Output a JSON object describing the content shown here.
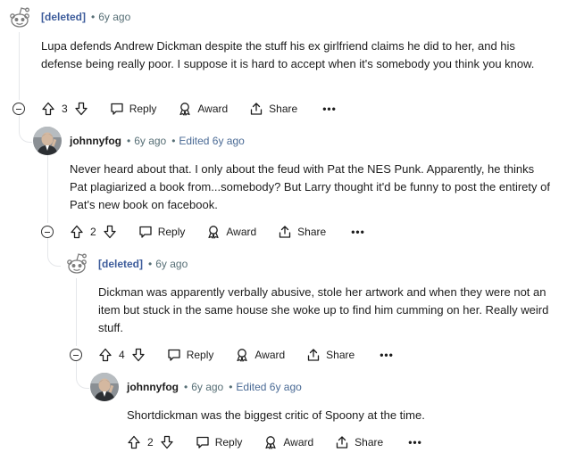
{
  "comments": [
    {
      "user": "[deleted]",
      "time": "6y ago",
      "edited": "",
      "body": "Lupa defends Andrew Dickman despite the stuff his ex girlfriend claims he did to her, and his defense being really poor. I suppose it is hard to accept when it's somebody you think you know.",
      "votes": "3"
    },
    {
      "user": "johnnyfog",
      "time": "6y ago",
      "edited": "Edited 6y ago",
      "body": "Never heard about that. I only about the feud with Pat the NES Punk. Apparently, he thinks Pat plagiarized a book from...somebody? But Larry thought it'd be funny to post the entirety of Pat's new book on facebook.",
      "votes": "2"
    },
    {
      "user": "[deleted]",
      "time": "6y ago",
      "edited": "",
      "body": "Dickman was apparently verbally abusive, stole her artwork and when they were not an item but stuck in the same house she woke up to find him cumming on her. Really weird stuff.",
      "votes": "4"
    },
    {
      "user": "johnnyfog",
      "time": "6y ago",
      "edited": "Edited 6y ago",
      "body": "Shortdickman was the biggest critic of Spoony at the time.",
      "votes": "2"
    }
  ],
  "labels": {
    "separator": "•",
    "reply": "Reply",
    "award": "Award",
    "share": "Share",
    "more": "•••"
  },
  "icons": [
    "snoo-avatar-icon",
    "user-avatar-icon",
    "collapse-icon",
    "upvote-icon",
    "downvote-icon",
    "reply-icon",
    "award-icon",
    "share-icon",
    "more-icon"
  ]
}
